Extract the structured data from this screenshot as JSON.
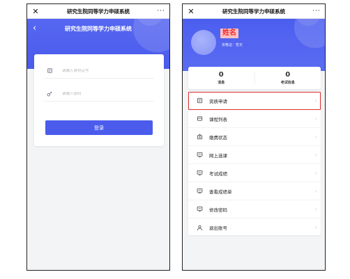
{
  "wechat": {
    "title": "研究生院同等学力申硕系统",
    "close_glyph": "✕",
    "more_glyph": "···"
  },
  "login": {
    "back_glyph": "‹",
    "header_title": "研究生院同等学力申硕系统",
    "id_placeholder": "请输入身份证号",
    "password_placeholder": "请输入密码",
    "login_button": "登录",
    "colors": {
      "primary": "#4b5ced"
    }
  },
  "profile": {
    "name_label": "姓名",
    "certificate": "资格证：暂无",
    "stats": [
      {
        "value": "0",
        "label": "消息"
      },
      {
        "value": "0",
        "label": "考试信息"
      }
    ],
    "menu": [
      {
        "label": "资质申请",
        "icon": "qualification-icon",
        "selected": true
      },
      {
        "label": "课程列表",
        "icon": "course-list-icon"
      },
      {
        "label": "缴费状态",
        "icon": "payment-icon"
      },
      {
        "label": "网上选课",
        "icon": "online-course-icon"
      },
      {
        "label": "考试成绩",
        "icon": "exam-score-icon"
      },
      {
        "label": "查看成绩单",
        "icon": "transcript-icon"
      },
      {
        "label": "修改密码",
        "icon": "password-icon"
      },
      {
        "label": "退出账号",
        "icon": "logout-icon"
      }
    ],
    "chevron_glyph": "›",
    "colors": {
      "highlight_border": "#d9302e",
      "name_text": "#ee2a2a"
    }
  }
}
